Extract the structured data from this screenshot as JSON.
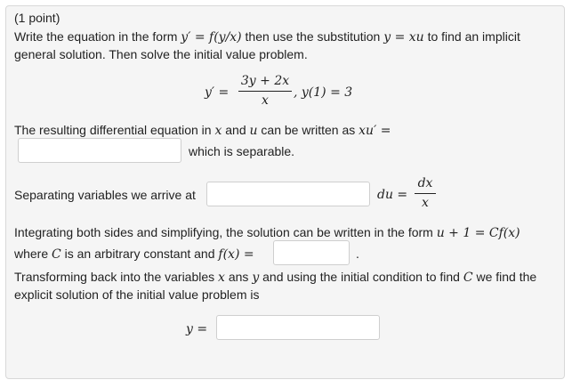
{
  "problem": {
    "points": "(1 point)",
    "instr_a": "Write the equation in the form",
    "instr_form": "y′ = f(y/x)",
    "instr_b": "then use the substitution",
    "instr_sub": "y = xu",
    "instr_c": "to find an implicit",
    "instr_line2": "general solution. Then solve the initial value problem.",
    "eq_lhs": "y′ =",
    "eq_num": "3y + 2x",
    "eq_den": "x",
    "eq_ic": ",  y(1) = 3",
    "resulting_text": "The resulting differential equation in",
    "resulting_x": "x",
    "resulting_and": "and",
    "resulting_u": "u",
    "resulting_tail": "can be written as",
    "resulting_expr": "xu′ =",
    "separable_text": "which is separable.",
    "separating_text": "Separating variables we arrive at",
    "du_label": "du =",
    "dx_num": "dx",
    "dx_den": "x",
    "integrating_text": "Integrating both sides and simplifying, the solution can be written in the form",
    "integrating_expr": "u + 1 = Cf(x)",
    "where_a": "where",
    "where_C": "C",
    "where_b": "is an arbitrary constant and",
    "where_fx": "f(x) =",
    "period": ".",
    "transform_a": "Transforming back into the variables",
    "transform_x": "x",
    "transform_ans": "ans",
    "transform_y": "y",
    "transform_b": "and using the initial condition to find",
    "transform_C": "C",
    "transform_c": "we find the",
    "explicit_text": "explicit solution of the initial value problem is",
    "y_label": "y ="
  },
  "inputs": {
    "resulting": "",
    "separating": "",
    "fx": "",
    "final_y": ""
  }
}
